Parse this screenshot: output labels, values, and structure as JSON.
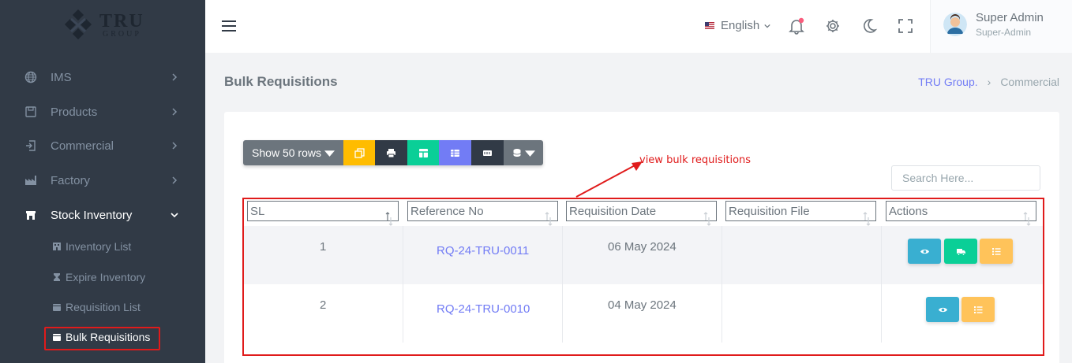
{
  "logo": {
    "word": "TRU",
    "sub": "GROUP"
  },
  "sidebar": {
    "items": [
      {
        "label": "IMS",
        "icon": "globe-icon"
      },
      {
        "label": "Products",
        "icon": "box-icon"
      },
      {
        "label": "Commercial",
        "icon": "login-icon"
      },
      {
        "label": "Factory",
        "icon": "factory-icon"
      },
      {
        "label": "Stock Inventory",
        "icon": "store-icon"
      }
    ],
    "sub_items": [
      {
        "label": "Inventory List",
        "icon": "building-icon"
      },
      {
        "label": "Expire Inventory",
        "icon": "hourglass-icon"
      },
      {
        "label": "Requisition List",
        "icon": "folder-icon"
      },
      {
        "label": "Bulk Requisitions",
        "icon": "folder-icon"
      }
    ]
  },
  "topbar": {
    "language": "English",
    "user_name": "Super Admin",
    "user_role": "Super-Admin"
  },
  "page": {
    "title": "Bulk Requisitions",
    "breadcrumb": [
      "TRU Group.",
      "Commercial"
    ]
  },
  "toolbar": {
    "show_rows": "Show 50 rows",
    "buttons": [
      {
        "name": "copy-icon",
        "color": "#ffbc00"
      },
      {
        "name": "print-icon",
        "color": "#313a46"
      },
      {
        "name": "csv-icon",
        "color": "#0acf97"
      },
      {
        "name": "excel-icon",
        "color": "#727cf5"
      },
      {
        "name": "pdf-icon",
        "color": "#313a46"
      },
      {
        "name": "columns-icon",
        "color": "#6c757d"
      }
    ]
  },
  "search": {
    "placeholder": "Search Here..."
  },
  "annotation": {
    "text": "view bulk requisitions"
  },
  "table": {
    "headers": [
      "SL",
      "Reference No",
      "Requisition Date",
      "Requisition File",
      "Actions"
    ],
    "rows": [
      {
        "sl": "1",
        "ref": "RQ-24-TRU-0011",
        "date": "06 May 2024",
        "file": "",
        "actions": [
          "view",
          "deliver",
          "list"
        ]
      },
      {
        "sl": "2",
        "ref": "RQ-24-TRU-0010",
        "date": "04 May 2024",
        "file": "",
        "actions": [
          "view",
          "list"
        ]
      }
    ]
  },
  "colors": {
    "sidebar": "#313a46",
    "accent": "#727cf5",
    "info": "#39afd1",
    "success": "#0acf97",
    "warning": "#ffc35a",
    "highlight": "#e01b1b"
  }
}
